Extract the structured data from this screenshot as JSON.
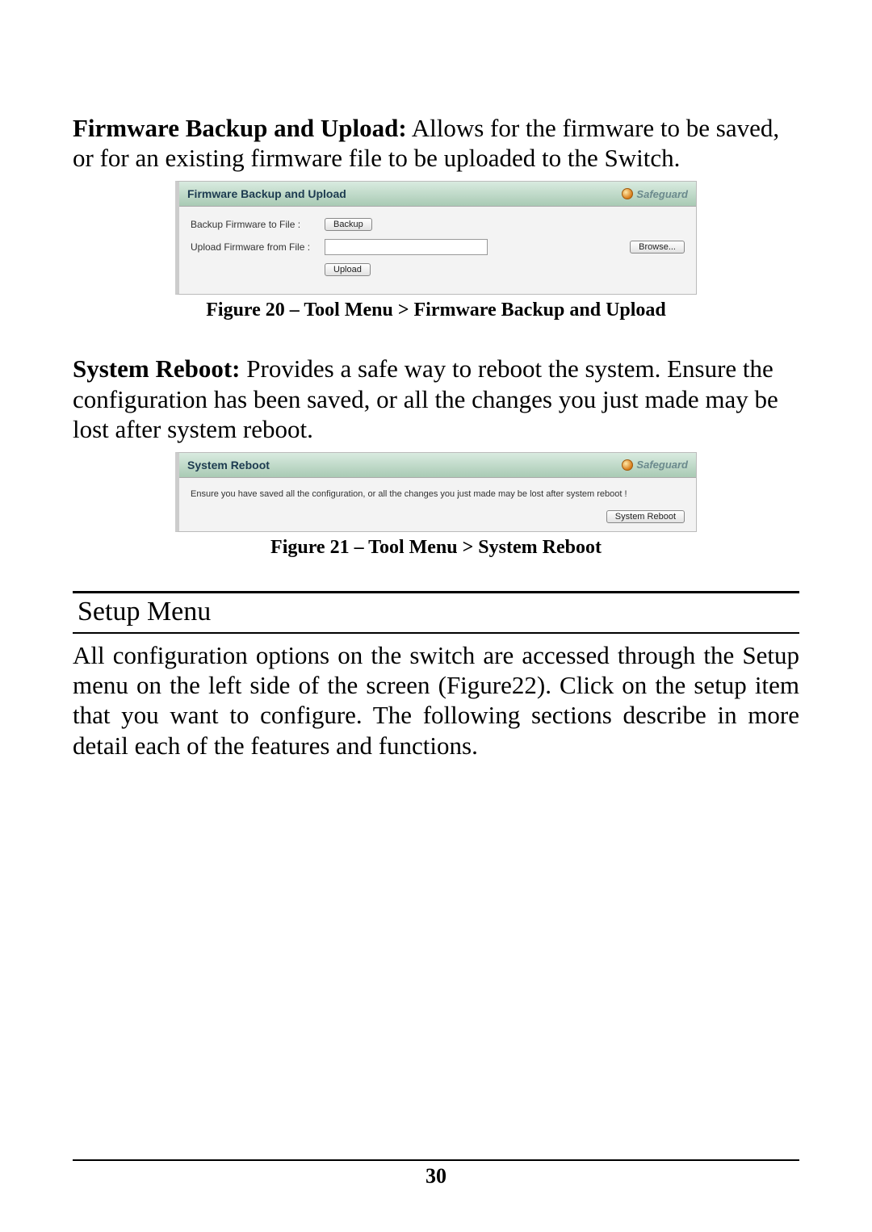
{
  "para1": {
    "lead_bold": "Firmware Backup and Upload:",
    "rest": " Allows for the firmware to be saved, or for an existing firmware file to be uploaded to the Switch."
  },
  "fw_panel": {
    "title": "Firmware Backup and Upload",
    "safeguard": "Safeguard",
    "row1_label": "Backup Firmware to File :",
    "row1_button": "Backup",
    "row2_label": "Upload Firmware from File :",
    "row2_browse": "Browse...",
    "row2_button": "Upload"
  },
  "caption1": "Figure 20 – Tool Menu > Firmware Backup and Upload",
  "para2": {
    "lead_bold": "System Reboot:",
    "rest": " Provides a safe way to reboot the system. Ensure the configuration has been saved, or all the changes you just made may be lost after system reboot."
  },
  "sr_panel": {
    "title": "System Reboot",
    "safeguard": "Safeguard",
    "msg": "Ensure you have saved all the configuration, or all the changes you just made may be lost after system reboot !",
    "button": "System Reboot"
  },
  "caption2": "Figure 21 – Tool Menu > System Reboot",
  "section_title": "Setup Menu",
  "para3": "All configuration options on the switch are accessed through the Setup menu on the left side of the screen (Figure22). Click on the setup item that you want to configure. The following sections describe in more detail each of the features and functions.",
  "page_number": "30"
}
